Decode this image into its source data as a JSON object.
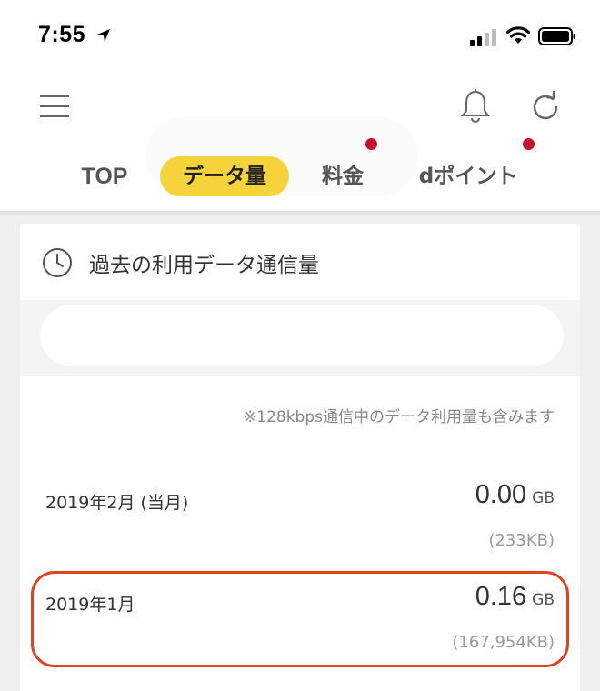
{
  "status_bar": {
    "time": "7:55",
    "icons": [
      "location-arrow-icon",
      "cell-signal-icon",
      "wifi-icon",
      "battery-icon"
    ]
  },
  "header": {
    "icons": [
      "hamburger-menu-icon",
      "bell-icon",
      "refresh-icon"
    ]
  },
  "tabs": [
    {
      "label": "TOP",
      "active": false,
      "badge": false
    },
    {
      "label": "データ量",
      "active": true,
      "badge": false
    },
    {
      "label": "料金",
      "active": false,
      "badge": true
    },
    {
      "label": "dポイント",
      "active": false,
      "badge": true
    }
  ],
  "card": {
    "title": "過去の利用データ通信量",
    "title_icon": "clock-icon",
    "note": "※128kbps通信中のデータ利用量も含みます",
    "rows": [
      {
        "month": "2019年2月 (当月)",
        "value": "0.00",
        "unit": "GB",
        "kb": "(233KB)"
      },
      {
        "month": "2019年1月",
        "value": "0.16",
        "unit": "GB",
        "kb": "(167,954KB)",
        "highlighted": true
      }
    ]
  },
  "colors": {
    "active_tab": "#f6d33a",
    "badge": "#c8102e",
    "highlight_outline": "#e0431f",
    "background": "#efefef"
  }
}
